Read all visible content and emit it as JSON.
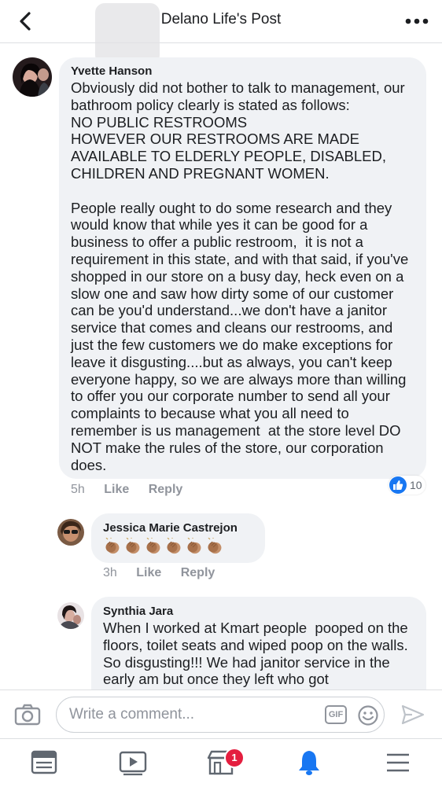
{
  "header": {
    "title": "Delano Life's Post"
  },
  "comments": [
    {
      "author": "Yvette Hanson",
      "text": "Obviously did not bother to talk to management, our bathroom policy clearly is stated as follows:\nNO PUBLIC RESTROOMS\nHOWEVER OUR RESTROOMS ARE MADE AVAILABLE TO ELDERLY PEOPLE, DISABLED, CHILDREN AND PREGNANT WOMEN.\n\nPeople really ought to do some research and they would know that while yes it can be good for a business to offer a public restroom,  it is not a requirement in this state, and with that said, if you've shopped in our store on a busy day, heck even on a slow one and saw how dirty some of our customer can be you'd understand...we don't have a janitor service that comes and cleans our restrooms, and just the few customers we do make exceptions for leave it disgusting....but as always, you can't keep everyone happy, so we are always more than willing to offer you our corporate number to send all your complaints to because what you all need to remember is us management  at the store level DO NOT make the rules of the store, our corporation does.",
      "time": "5h",
      "like": "Like",
      "reply": "Reply",
      "reaction_count": "10"
    },
    {
      "author": "Jessica Marie Castrejon",
      "time": "3h",
      "like": "Like",
      "reply": "Reply",
      "emoji_name": "clapping-hands-icon",
      "emoji_count": 6
    },
    {
      "author": "Synthia Jara",
      "text": "When I worked at Kmart people  pooped on the floors, toilet seats and wiped poop on the walls. So disgusting!!! We had janitor service in the early am but once they left who got"
    }
  ],
  "composer": {
    "placeholder": "Write a comment...",
    "gif_label": "GIF"
  },
  "tabbar": {
    "marketplace_badge": "1"
  },
  "colors": {
    "bubble": "#f0f2f5",
    "accent_blue": "#1877f2",
    "badge_red": "#e41e3f",
    "muted_text": "#90949c"
  }
}
